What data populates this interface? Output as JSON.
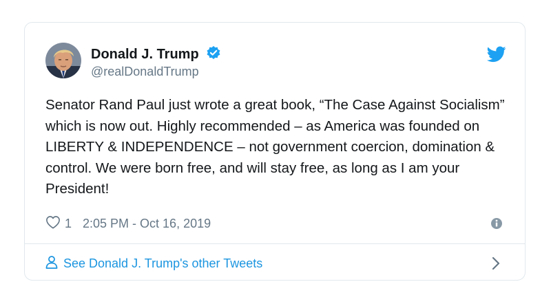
{
  "tweet": {
    "author_name": "Donald J. Trump",
    "handle": "@realDonaldTrump",
    "text": "Senator Rand Paul just wrote a great book, “The Case Against Socialism” which is now out. Highly recommended – as America was founded on LIBERTY & INDEPENDENCE – not government coercion, domination & control. We were born free, and will stay free, as long as I am your President!",
    "like_count": "1",
    "timestamp": "2:05 PM - Oct 16, 2019",
    "other_tweets_link": "See Donald J. Trump's other Tweets"
  },
  "icons": {
    "verified": "verified-badge-icon",
    "brand": "twitter-bird-icon",
    "like": "heart-icon",
    "info": "info-icon",
    "profile": "person-icon",
    "more": "chevron-right-icon"
  },
  "colors": {
    "accent": "#1da1f2",
    "link": "#1b95e0",
    "text": "#14171a",
    "secondary_text": "#657786",
    "border": "#e1e8ed"
  }
}
